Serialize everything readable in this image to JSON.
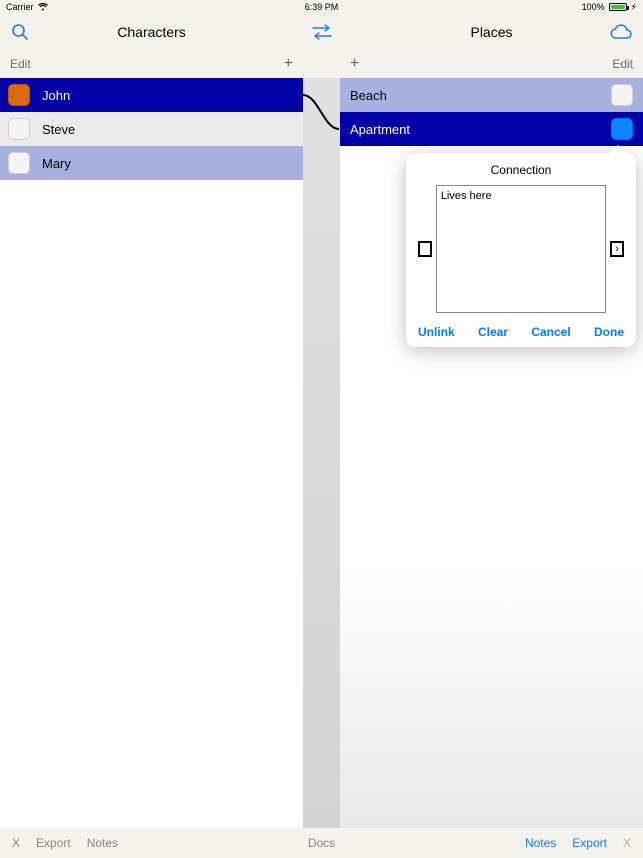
{
  "statusbar": {
    "carrier": "Carrier",
    "time": "6:39 PM",
    "battery": "100%"
  },
  "header": {
    "left_title": "Characters",
    "right_title": "Places"
  },
  "toolbar": {
    "edit": "Edit",
    "plus": "+"
  },
  "left_pane": {
    "items": [
      {
        "name": "John",
        "selected": true,
        "swatch": "orange"
      },
      {
        "name": "Steve",
        "selected": false,
        "swatch": "empty",
        "alt": true
      },
      {
        "name": "Mary",
        "selected": false,
        "swatch": "empty",
        "linked": true
      }
    ]
  },
  "right_pane": {
    "items": [
      {
        "name": "Beach",
        "selected": false,
        "linked": true,
        "swatch": "empty"
      },
      {
        "name": "Apartment",
        "selected": true,
        "swatch": "blue"
      }
    ]
  },
  "popover": {
    "title": "Connection",
    "text": "Lives here",
    "actions": {
      "unlink": "Unlink",
      "clear": "Clear",
      "cancel": "Cancel",
      "done": "Done"
    }
  },
  "bottombar": {
    "left": {
      "x": "X",
      "export": "Export",
      "notes": "Notes"
    },
    "center": "Docs",
    "right": {
      "notes": "Notes",
      "export": "Export",
      "x": "X"
    }
  }
}
